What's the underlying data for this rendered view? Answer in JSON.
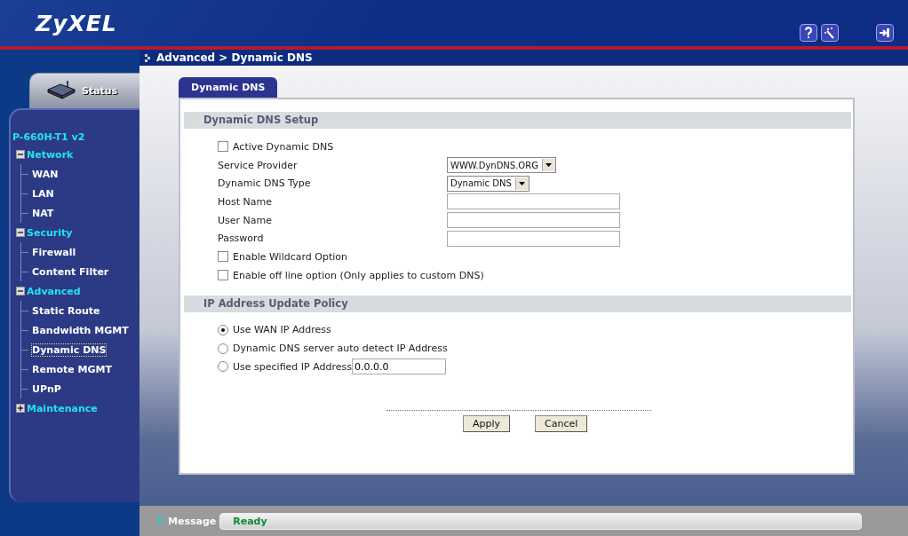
{
  "header": {
    "logo": "ZyXEL"
  },
  "breadcrumb": "Advanced > Dynamic DNS",
  "status_tab": {
    "label": "Status"
  },
  "sidebar": {
    "device": "P-660H-T1 v2",
    "groups": [
      {
        "label": "Network",
        "expanded": true,
        "children": [
          {
            "label": "WAN",
            "selected": false
          },
          {
            "label": "LAN",
            "selected": false
          },
          {
            "label": "NAT",
            "selected": false
          }
        ]
      },
      {
        "label": "Security",
        "expanded": true,
        "children": [
          {
            "label": "Firewall",
            "selected": false
          },
          {
            "label": "Content Filter",
            "selected": false
          }
        ]
      },
      {
        "label": "Advanced",
        "expanded": true,
        "children": [
          {
            "label": "Static Route",
            "selected": false
          },
          {
            "label": "Bandwidth MGMT",
            "selected": false
          },
          {
            "label": "Dynamic DNS",
            "selected": true
          },
          {
            "label": "Remote MGMT",
            "selected": false
          },
          {
            "label": "UPnP",
            "selected": false
          }
        ]
      },
      {
        "label": "Maintenance",
        "expanded": false
      }
    ]
  },
  "tabs": [
    {
      "label": "Dynamic DNS",
      "selected": true
    }
  ],
  "sections": [
    {
      "title": "Dynamic DNS Setup",
      "rows": [
        {
          "kind": "checkbox",
          "label": "Active Dynamic DNS",
          "checked": false
        },
        {
          "kind": "select",
          "label": "Service Provider",
          "value": "WWW.DynDNS.ORG"
        },
        {
          "kind": "select",
          "label": "Dynamic DNS Type",
          "value": "Dynamic DNS"
        },
        {
          "kind": "text",
          "label": "Host Name"
        },
        {
          "kind": "text",
          "label": "User Name"
        },
        {
          "kind": "text",
          "label": "Password"
        },
        {
          "kind": "checkbox",
          "label": "Enable Wildcard Option",
          "checked": false
        },
        {
          "kind": "checkbox",
          "label": "Enable off line option (Only applies to custom DNS)",
          "checked": false
        }
      ]
    },
    {
      "title": "IP Address Update Policy",
      "rows": [
        {
          "kind": "radio",
          "label": "Use WAN IP Address",
          "selected": true
        },
        {
          "kind": "radio",
          "label": "Dynamic DNS server auto detect IP Address",
          "selected": false
        },
        {
          "kind": "radio",
          "label": "Use specified IP Address",
          "selected": false,
          "value": "0.0.0.0"
        }
      ]
    }
  ],
  "buttons": [
    "Apply",
    "Cancel"
  ],
  "status_bar": {
    "label": "Message",
    "value": "Ready"
  }
}
